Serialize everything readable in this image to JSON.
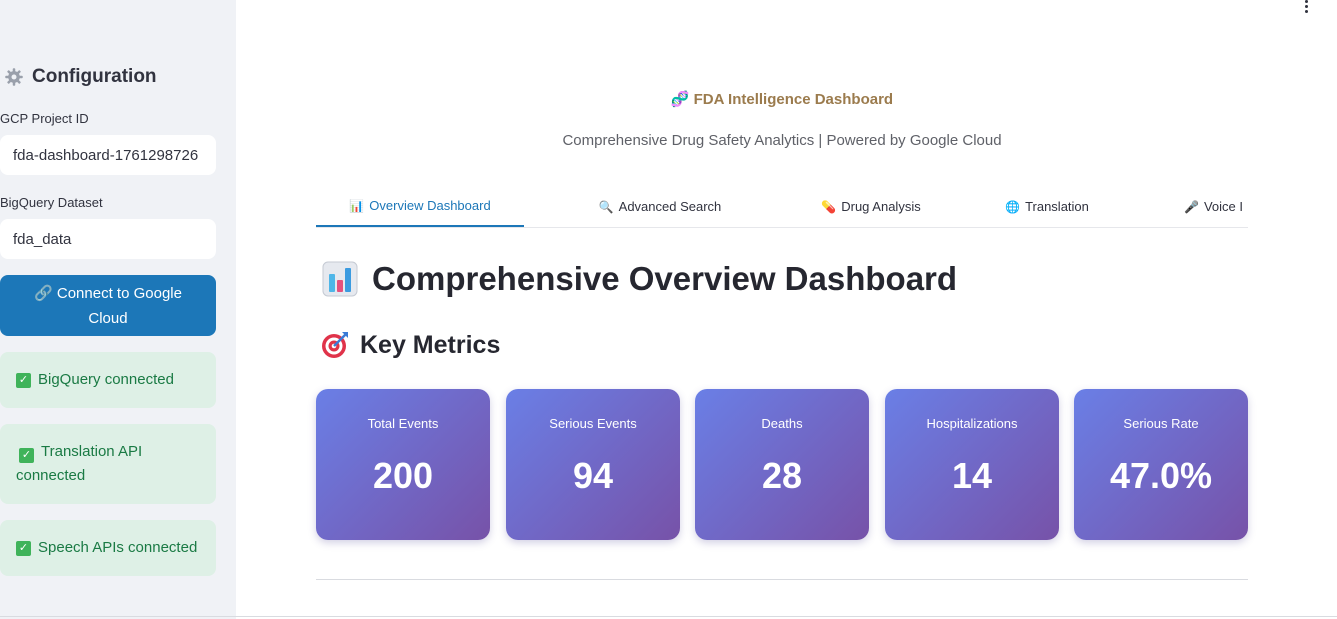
{
  "sidebar": {
    "title": "Configuration",
    "project_label": "GCP Project ID",
    "project_value": "fda-dashboard-1761298726",
    "dataset_label": "BigQuery Dataset",
    "dataset_value": "fda_data",
    "connect_label": "🔗 Connect to Google Cloud",
    "status": [
      "BigQuery connected",
      "Translation API connected",
      "Speech APIs connected"
    ]
  },
  "header": {
    "title": "FDA Intelligence Dashboard",
    "subtitle": "Comprehensive Drug Safety Analytics | Powered by Google Cloud"
  },
  "tabs": [
    {
      "icon": "📊",
      "label": "Overview Dashboard",
      "active": true
    },
    {
      "icon": "🔍",
      "label": "Advanced Search"
    },
    {
      "icon": "💊",
      "label": "Drug Analysis"
    },
    {
      "icon": "🌐",
      "label": "Translation"
    },
    {
      "icon": "🎤",
      "label": "Voice I"
    }
  ],
  "main": {
    "heading": "Comprehensive Overview Dashboard",
    "subheading": "Key Metrics",
    "metrics": [
      {
        "label": "Total Events",
        "value": "200"
      },
      {
        "label": "Serious Events",
        "value": "94"
      },
      {
        "label": "Deaths",
        "value": "28"
      },
      {
        "label": "Hospitalizations",
        "value": "14"
      },
      {
        "label": "Serious Rate",
        "value": "47.0%"
      }
    ]
  },
  "colors": {
    "accent": "#1c77b8",
    "sidebar_bg": "#f0f2f6",
    "success_bg": "#def0e6",
    "success_text": "#1a7a44",
    "card_gradient_start": "#6a7fe6",
    "card_gradient_end": "#7752a8",
    "title_color": "#9b7b4d"
  }
}
